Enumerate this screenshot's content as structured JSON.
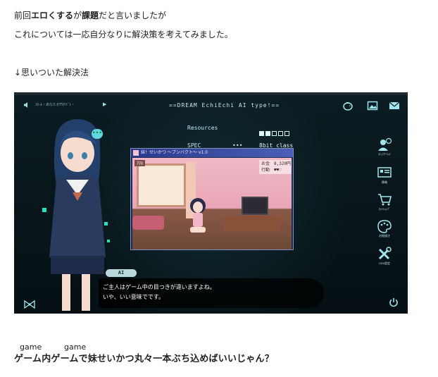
{
  "article": {
    "line1_pre": "前回",
    "line1_bold1": "エロくする",
    "line1_mid": "が",
    "line1_bold2": "課題",
    "line1_post": "だと言いましたが",
    "line2": "これについては一応自分なりに解決策を考えてみました。",
    "line3": "↓思いついた解決法"
  },
  "game": {
    "top_left_text": "ｽﾀｰﾙ・あなたがTVｸﾄﾞﾋ・",
    "title": "==DREAM EchiEchi AI type!==",
    "stats": {
      "resources_label": "Resources",
      "resources_level": 2,
      "resources_max": 5,
      "spec_label": "SPEC",
      "spec_sep": "•••",
      "spec_value": "8bit class"
    },
    "inner_window": {
      "title": "妹！せいかつ ～ブンバクト～ v1.0",
      "name_tag": "ｱﾏﾈ",
      "money_line": "お金　8,320円",
      "action_line": "行動　♥♥♡"
    },
    "ai_tag": "AI",
    "dialog": {
      "line1": "ご主人はゲーム中の目つきが違いますよね。",
      "line2": "いや、いい意味でです。"
    },
    "menu": [
      {
        "icon": "user-chat-icon",
        "label": "ｺﾐｭﾆｹｰｼｮﾝ"
      },
      {
        "icon": "card-icon",
        "label": "情報"
      },
      {
        "icon": "cart-icon",
        "label": "ﾈｯﾄｼｮｯﾌﾟ"
      },
      {
        "icon": "palette-icon",
        "label": "お絵描き"
      },
      {
        "icon": "tools-icon",
        "label": "ｼｽﾃﾑ設定"
      }
    ],
    "accent_color": "#9fe6ef"
  },
  "bottom": {
    "ruby1": "game",
    "ruby2": "game",
    "headline": "ゲーム内ゲームで妹せいかつ丸々一本ぶち込めばいいじゃん？"
  }
}
